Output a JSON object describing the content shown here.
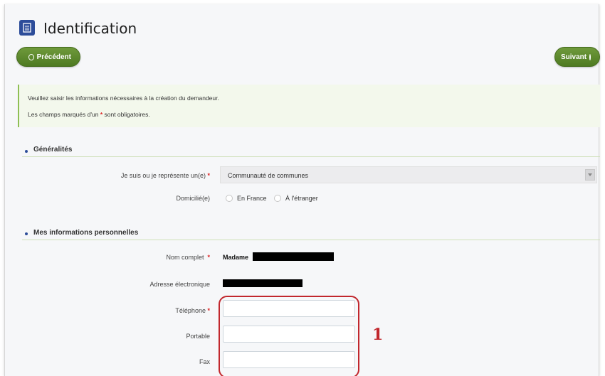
{
  "header": {
    "title": "Identification"
  },
  "nav": {
    "prev_label": "Précédent",
    "next_label": "Suivant"
  },
  "info": {
    "line1": "Veuillez saisir les informations nécessaires à la création du demandeur.",
    "line2_prefix": "Les champs marqués d'un",
    "line2_star": "*",
    "line2_suffix": "sont obligatoires."
  },
  "sections": {
    "general": {
      "title": "Généralités"
    },
    "personal": {
      "title": "Mes informations personnelles"
    }
  },
  "fields": {
    "represent": {
      "label": "Je suis ou je représente un(e)",
      "required_mark": "*",
      "value": "Communauté de communes"
    },
    "domicile": {
      "label": "Domicilié(e)",
      "options": [
        "En France",
        "À l'étranger"
      ]
    },
    "fullname": {
      "label": "Nom complet",
      "required_mark": "*",
      "value": "Madame"
    },
    "email": {
      "label": "Adresse électronique"
    },
    "phone": {
      "label": "Téléphone",
      "required_mark": "*",
      "value": ""
    },
    "mobile": {
      "label": "Portable",
      "value": ""
    },
    "fax": {
      "label": "Fax",
      "value": ""
    }
  },
  "annotation": {
    "number": "1",
    "color": "#c1272d"
  },
  "colors": {
    "accent_green": "#5b8a2c",
    "brand_blue": "#2d4d9a",
    "required_red": "#d22"
  }
}
